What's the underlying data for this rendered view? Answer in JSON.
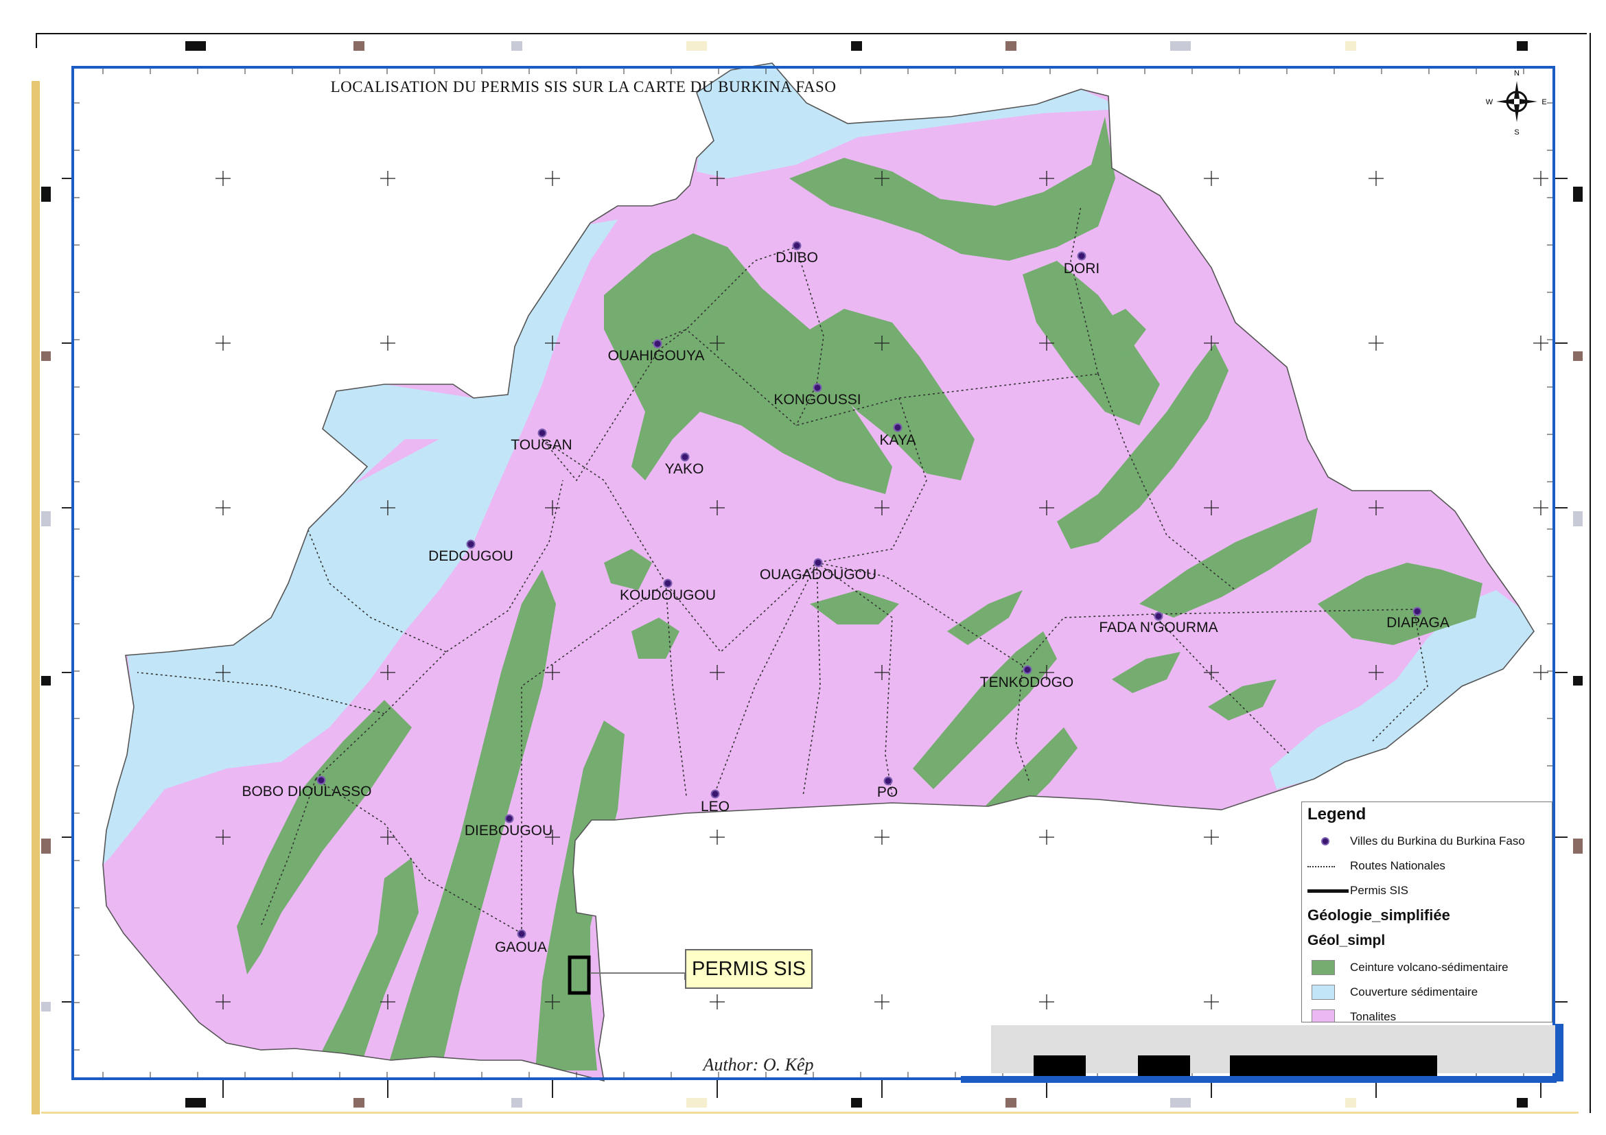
{
  "map": {
    "title": "LOCALISATION DU PERMIS SIS SUR LA CARTE DU BURKINA FASO",
    "author": "Author: O. Kêp",
    "compass": {
      "n": "N",
      "s": "S",
      "e": "E",
      "w": "W"
    },
    "callout_label": "PERMIS SIS",
    "colors": {
      "ceinture": "#74ad6f",
      "couverture": "#c2e6f8",
      "tonalites": "#ecb8f4",
      "city_dot": "#3a1670",
      "frame": "#1a5cc3"
    },
    "cities": [
      {
        "name": "DJIBO"
      },
      {
        "name": "DORI"
      },
      {
        "name": "OUAHIGOUYA"
      },
      {
        "name": "KONGOUSSI"
      },
      {
        "name": "TOUGAN"
      },
      {
        "name": "KAYA"
      },
      {
        "name": "YAKO"
      },
      {
        "name": "DEDOUGOU"
      },
      {
        "name": "OUAGADOUGOU"
      },
      {
        "name": "KOUDOUGOU"
      },
      {
        "name": "DIAPAGA"
      },
      {
        "name": "FADA N'GOURMA"
      },
      {
        "name": "TENKODOGO"
      },
      {
        "name": "BOBO DIOULASSO"
      },
      {
        "name": "LEO"
      },
      {
        "name": "PO"
      },
      {
        "name": "DIEBOUGOU"
      },
      {
        "name": "GAOUA"
      }
    ]
  },
  "legend": {
    "title": "Legend",
    "villes": "Villes du Burkina du Burkina Faso",
    "routes": "Routes Nationales",
    "permis": "Permis SIS",
    "geology_title": "Géologie_simplifiée",
    "geol_field": "Géol_simpl",
    "ceinture": "Ceinture volcano-sédimentaire",
    "couverture": "Couverture sédimentaire",
    "tonalites": "Tonalites"
  }
}
